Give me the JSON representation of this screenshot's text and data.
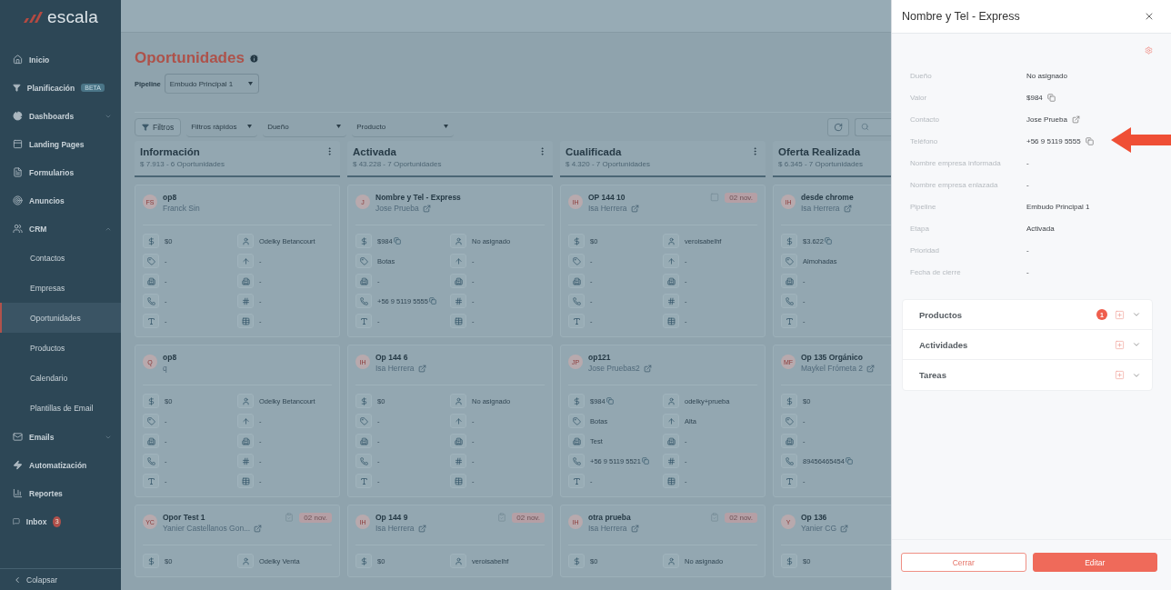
{
  "sidebar": {
    "logo": "escala",
    "items": [
      {
        "kind": "home",
        "label": "Inicio",
        "selected": false
      },
      {
        "kind": "funnel",
        "label": "Planificación",
        "badge": "BETA",
        "selected": false
      },
      {
        "kind": "pie",
        "label": "Dashboards",
        "expanded": false,
        "selected": false
      },
      {
        "kind": "page",
        "label": "Landing Pages",
        "selected": false
      },
      {
        "kind": "form",
        "label": "Formularios",
        "selected": false
      },
      {
        "kind": "target",
        "label": "Anuncios",
        "selected": false
      },
      {
        "kind": "users",
        "label": "CRM",
        "expanded": true,
        "selected": false,
        "children": [
          {
            "label": "Contactos",
            "selected": false
          },
          {
            "label": "Empresas",
            "selected": false
          },
          {
            "label": "Oportunidades",
            "selected": true
          },
          {
            "label": "Productos",
            "selected": false
          },
          {
            "label": "Calendario",
            "selected": false
          },
          {
            "label": "Plantillas de Email",
            "selected": false
          }
        ]
      },
      {
        "kind": "mail",
        "label": "Emails",
        "expanded": false,
        "selected": false
      },
      {
        "kind": "bolt",
        "label": "Automatización",
        "selected": false
      },
      {
        "kind": "chart",
        "label": "Reportes",
        "selected": false
      },
      {
        "kind": "chat",
        "label": "Inbox",
        "badge": "3",
        "selected": false
      }
    ],
    "collapse": "Colapsar"
  },
  "page": {
    "title": "Oportunidades",
    "pipeline_label": "Pipeline",
    "pipeline_value": "Embudo Principal 1"
  },
  "toolbar": {
    "filter_button": "Filtros",
    "dropdowns": [
      "Filtros rápidos",
      "Dueño",
      "Producto"
    ]
  },
  "columns": [
    {
      "title": "Información",
      "summary": "$ 7.913 - 6 Oportunidades",
      "cards": [
        {
          "initials": "FS",
          "title": "op8",
          "subtitle": "Franck Sin",
          "linked": false,
          "rows": [
            [
              {
                "value": "$0",
                "copyable": false
              },
              {
                "value": "Odelky Betancourt",
                "copyable": false
              }
            ],
            [
              {
                "value": "-",
                "copyable": false
              },
              {
                "value": "-",
                "copyable": false
              }
            ],
            [
              {
                "value": "-",
                "copyable": false
              },
              {
                "value": "-",
                "copyable": false
              }
            ],
            [
              {
                "value": "-",
                "copyable": false
              },
              {
                "value": "-",
                "copyable": false
              }
            ],
            [
              {
                "value": "-",
                "copyable": false
              },
              {
                "value": "-",
                "copyable": false
              }
            ]
          ]
        },
        {
          "initials": "Q",
          "title": "op8",
          "subtitle": "q",
          "linked": false,
          "rows": [
            [
              {
                "value": "$0",
                "copyable": false
              },
              {
                "value": "Odelky Betancourt",
                "copyable": false
              }
            ],
            [
              {
                "value": "-",
                "copyable": false
              },
              {
                "value": "-",
                "copyable": false
              }
            ],
            [
              {
                "value": "-",
                "copyable": false
              },
              {
                "value": "-",
                "copyable": false
              }
            ],
            [
              {
                "value": "-",
                "copyable": false
              },
              {
                "value": "-",
                "copyable": false
              }
            ],
            [
              {
                "value": "-",
                "copyable": false
              },
              {
                "value": "-",
                "copyable": false
              }
            ]
          ]
        },
        {
          "initials": "YC",
          "title": "Opor Test 1",
          "subtitle": "Yanier Castellanos Gon...",
          "linked": true,
          "due": "02 nov.",
          "rows": [
            [
              {
                "value": "$0",
                "copyable": false
              },
              {
                "value": "Odelky Venta",
                "copyable": false
              }
            ]
          ]
        }
      ]
    },
    {
      "title": "Activada",
      "summary": "$ 43.228 - 7 Oportunidades",
      "cards": [
        {
          "initials": "J",
          "title": "Nombre y Tel - Express",
          "subtitle": "Jose Prueba",
          "linked": true,
          "rows": [
            [
              {
                "value": "$984",
                "copyable": true
              },
              {
                "value": "No asignado",
                "copyable": false
              }
            ],
            [
              {
                "value": "Botas",
                "copyable": false
              },
              {
                "value": "-",
                "copyable": false
              }
            ],
            [
              {
                "value": "-",
                "copyable": false
              },
              {
                "value": "-",
                "copyable": false
              }
            ],
            [
              {
                "value": "+56 9 5119 5555",
                "copyable": true
              },
              {
                "value": "-",
                "copyable": false
              }
            ],
            [
              {
                "value": "-",
                "copyable": false
              },
              {
                "value": "-",
                "copyable": false
              }
            ]
          ]
        },
        {
          "initials": "IH",
          "title": "Op 144 6",
          "subtitle": "Isa Herrera",
          "linked": true,
          "rows": [
            [
              {
                "value": "$0",
                "copyable": false
              },
              {
                "value": "No asignado",
                "copyable": false
              }
            ],
            [
              {
                "value": "-",
                "copyable": false
              },
              {
                "value": "-",
                "copyable": false
              }
            ],
            [
              {
                "value": "-",
                "copyable": false
              },
              {
                "value": "-",
                "copyable": false
              }
            ],
            [
              {
                "value": "-",
                "copyable": false
              },
              {
                "value": "-",
                "copyable": false
              }
            ],
            [
              {
                "value": "-",
                "copyable": false
              },
              {
                "value": "-",
                "copyable": false
              }
            ]
          ]
        },
        {
          "initials": "IH",
          "title": "Op 144 9",
          "subtitle": "Isa Herrera",
          "linked": true,
          "due": "02 nov.",
          "rows": [
            [
              {
                "value": "$0",
                "copyable": false
              },
              {
                "value": "veroisabelhf",
                "copyable": false
              }
            ]
          ]
        }
      ]
    },
    {
      "title": "Cualificada",
      "summary": "$ 4.320 - 7 Oportunidades",
      "cards": [
        {
          "initials": "IH",
          "title": "OP 144 10",
          "subtitle": "Isa Herrera",
          "linked": true,
          "due": "02 nov.",
          "rows": [
            [
              {
                "value": "$0",
                "copyable": false
              },
              {
                "value": "veroisabelhf",
                "copyable": false
              }
            ],
            [
              {
                "value": "-",
                "copyable": false
              },
              {
                "value": "-",
                "copyable": false
              }
            ],
            [
              {
                "value": "-",
                "copyable": false
              },
              {
                "value": "-",
                "copyable": false
              }
            ],
            [
              {
                "value": "-",
                "copyable": false
              },
              {
                "value": "-",
                "copyable": false
              }
            ],
            [
              {
                "value": "-",
                "copyable": false
              },
              {
                "value": "-",
                "copyable": false
              }
            ]
          ]
        },
        {
          "initials": "JP",
          "title": "op121",
          "subtitle": "Jose Pruebas2",
          "linked": true,
          "rows": [
            [
              {
                "value": "$984",
                "copyable": true
              },
              {
                "value": "odelky+prueba",
                "copyable": false
              }
            ],
            [
              {
                "value": "Botas",
                "copyable": false
              },
              {
                "value": "Alta",
                "copyable": false
              }
            ],
            [
              {
                "value": "Test",
                "copyable": false
              },
              {
                "value": "-",
                "copyable": false
              }
            ],
            [
              {
                "value": "+56 9 5119 5521",
                "copyable": true
              },
              {
                "value": "-",
                "copyable": false
              }
            ],
            [
              {
                "value": "-",
                "copyable": false
              },
              {
                "value": "-",
                "copyable": false
              }
            ]
          ]
        },
        {
          "initials": "IH",
          "title": "otra prueba",
          "subtitle": "Isa Herrera",
          "linked": true,
          "due": "02 nov.",
          "rows": [
            [
              {
                "value": "$0",
                "copyable": false
              },
              {
                "value": "No asignado",
                "copyable": false
              }
            ]
          ]
        }
      ]
    },
    {
      "title": "Oferta Realizada",
      "summary": "$ 6.345 - 7 Oportunidades",
      "cards": [
        {
          "initials": "IH",
          "title": "desde chrome",
          "subtitle": "Isa Herrera",
          "linked": true,
          "rows": [
            [
              {
                "value": "$3.622",
                "copyable": true
              }
            ],
            [
              {
                "value": "Almohadas",
                "copyable": false
              }
            ],
            [
              {
                "value": "-",
                "copyable": false
              }
            ],
            [
              {
                "value": "-",
                "copyable": false
              }
            ],
            [
              {
                "value": "-",
                "copyable": false
              }
            ]
          ]
        },
        {
          "initials": "MF",
          "title": "Op 135 Orgánico",
          "subtitle": "Maykel Frómeta 2",
          "linked": true,
          "rows": [
            [
              {
                "value": "$0",
                "copyable": false
              }
            ],
            [
              {
                "value": "-",
                "copyable": false
              }
            ],
            [
              {
                "value": "-",
                "copyable": false
              }
            ],
            [
              {
                "value": "89456465454",
                "copyable": true
              }
            ],
            [
              {
                "value": "-",
                "copyable": false
              }
            ]
          ]
        },
        {
          "initials": "Y",
          "title": "Op 136",
          "subtitle": "Yanier CG",
          "linked": true,
          "rows": [
            [
              {
                "value": "$0",
                "copyable": false
              }
            ]
          ]
        }
      ]
    }
  ],
  "panel": {
    "title": "Nombre y Tel - Express",
    "fields": [
      {
        "label": "Dueño",
        "value": "No asignado",
        "kind": "text"
      },
      {
        "label": "Valor",
        "value": "$984",
        "kind": "copy"
      },
      {
        "label": "Contacto",
        "value": "Jose Prueba",
        "kind": "link"
      },
      {
        "label": "Teléfono",
        "value": "+56 9 5119 5555",
        "kind": "copy"
      },
      {
        "label": "Nombre empresa informada",
        "value": "-",
        "kind": "text"
      },
      {
        "label": "Nombre empresa enlazada",
        "value": "-",
        "kind": "text"
      },
      {
        "label": "Pipeline",
        "value": "Embudo Principal 1",
        "kind": "text"
      },
      {
        "label": "Etapa",
        "value": "Activada",
        "kind": "text"
      },
      {
        "label": "Prioridad",
        "value": "-",
        "kind": "text"
      },
      {
        "label": "Fecha de cierre",
        "value": "-",
        "kind": "text"
      }
    ],
    "sections": [
      {
        "label": "Productos",
        "count": "1"
      },
      {
        "label": "Actividades"
      },
      {
        "label": "Tareas"
      }
    ],
    "buttons": [
      {
        "label": "Cerrar",
        "kind": "secondary"
      },
      {
        "label": "Editar",
        "kind": "primary"
      }
    ]
  }
}
